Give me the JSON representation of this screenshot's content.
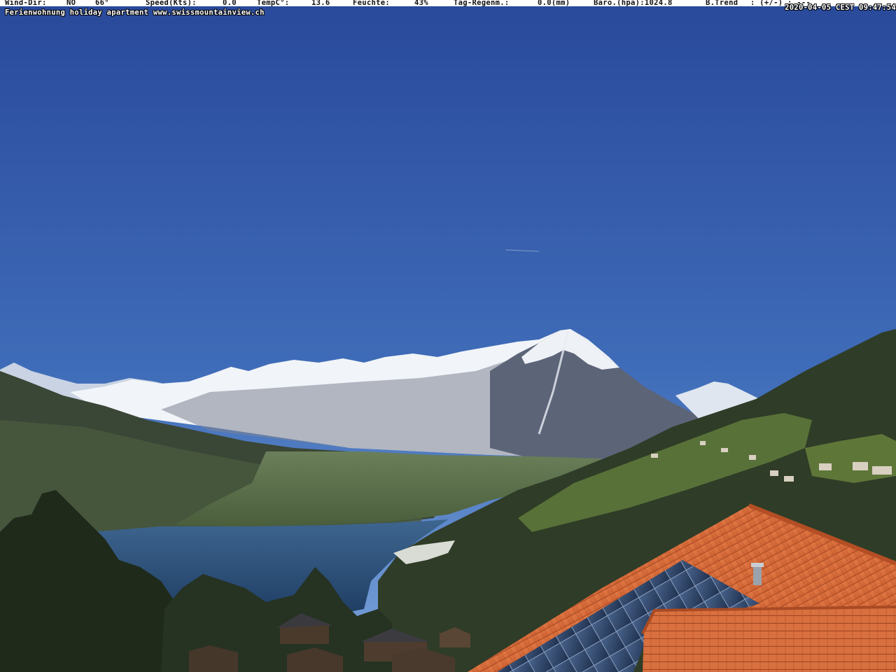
{
  "overlay": {
    "wind_dir_label": "Wind-Dir:",
    "wind_dir_value": "NO",
    "wind_dir_deg": "66°",
    "speed_label": "Speed(Kts):",
    "speed_value": "0.0",
    "temp_label": "TempC°:",
    "temp_value": "13.6",
    "humidity_label": "Feuchte:",
    "humidity_value": "43%",
    "rain_label": "Tag-Regenm.:",
    "rain_value": "0.0(mm)",
    "baro_label": "Baro.(hpa):1024.8",
    "trend_label": "B.Trend",
    "trend_value": ": (+/-) : ---",
    "timestamp": "2020-04-05 CEST 09:47:54",
    "caption": "Ferienwohnung holiday apartment www.swissmountainview.ch"
  },
  "colors": {
    "sky_top": "#2a4d9c",
    "sky_bottom": "#6f9ad6",
    "snow": "#f4f6f8",
    "mountain_rock": "#5b6373",
    "forest": "#2f3a26",
    "lake": "#2c4f7a",
    "roof_tile": "#d86c3c",
    "solar_panel": "#2f4466"
  }
}
